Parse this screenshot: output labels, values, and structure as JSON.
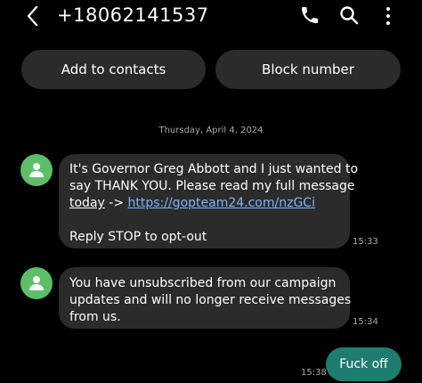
{
  "header": {
    "contact_number": "+18062141537"
  },
  "actions": {
    "add_to_contacts": "Add to contacts",
    "block_number": "Block number"
  },
  "conversation": {
    "date_divider": "Thursday, April 4, 2024",
    "messages": [
      {
        "direction": "incoming",
        "line1": "It's Governor Greg Abbott and I just wanted to",
        "line2": "say THANK YOU. Please read my full message",
        "today_word": "today",
        "arrow": " -> ",
        "link": "https://gopteam24.com/nzGCi",
        "line4": "Reply STOP to opt-out",
        "time": "15:33"
      },
      {
        "direction": "incoming",
        "line1": "You have unsubscribed from our campaign",
        "line2": "updates and will no longer receive messages",
        "line3": "from us.",
        "time": "15:34"
      },
      {
        "direction": "outgoing",
        "text": "Fuck off",
        "time": "15:38"
      }
    ]
  },
  "colors": {
    "background": "#000000",
    "incoming_bubble": "#2b2b2b",
    "outgoing_bubble": "#1f7d6f",
    "avatar": "#5dbe6a",
    "link": "#79b6ff"
  },
  "icons": [
    "back-arrow-icon",
    "phone-icon",
    "search-icon",
    "more-vertical-icon",
    "person-icon"
  ]
}
